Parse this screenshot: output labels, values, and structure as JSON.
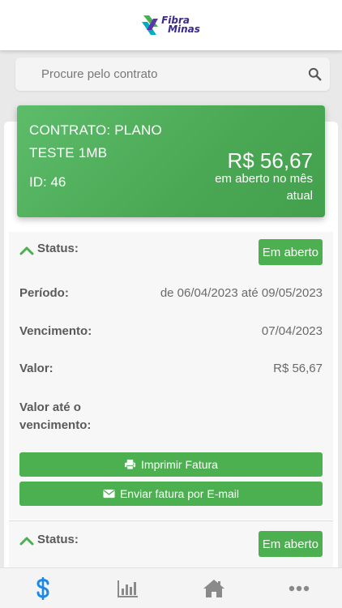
{
  "app": {
    "logo_line1": "Fibra",
    "logo_line2": "Minas"
  },
  "search": {
    "placeholder": "Procure pelo contrato"
  },
  "contract": {
    "title": "CONTRATO: PLANO TESTE 1MB",
    "id_label": "ID: 46",
    "amount": "R$ 56,67",
    "amount_note": "em aberto no mês atual"
  },
  "invoices": [
    {
      "status_label": "Status:",
      "status_value": "Em aberto",
      "period_label": "Período:",
      "period_value": "de 06/04/2023 até 09/05/2023",
      "due_label": "Vencimento:",
      "due_value": "07/04/2023",
      "value_label": "Valor:",
      "value_value": "R$ 56,67",
      "value_until_due_label": "Valor até o vencimento:",
      "print_button": "Imprimir Fatura",
      "email_button": "Enviar fatura por E-mail"
    },
    {
      "status_label": "Status:",
      "status_value": "Em aberto"
    }
  ],
  "nav": {
    "items": [
      "dollar-icon",
      "chart-icon",
      "home-icon",
      "more-icon"
    ],
    "active_color": "#1e88e5",
    "inactive_color": "#8a8a8a"
  },
  "colors": {
    "accent_green": "#4caf50",
    "card_green": "#4aa854"
  }
}
